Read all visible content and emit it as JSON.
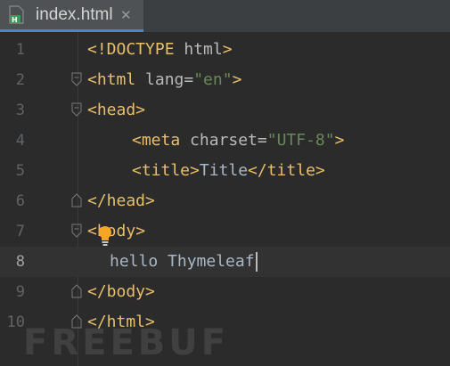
{
  "tab": {
    "title": "index.html",
    "icon": "html-file-icon",
    "close_symbol": "✕",
    "file_badge": "H"
  },
  "lines": [
    {
      "number": "1",
      "parts": [
        "<!DOCTYPE",
        " html",
        ">"
      ]
    },
    {
      "number": "2",
      "parts": [
        "<html",
        " lang=",
        "\"en\"",
        ">"
      ]
    },
    {
      "number": "3",
      "parts": [
        "<head>"
      ]
    },
    {
      "number": "4",
      "parts": [
        "<meta",
        " charset=",
        "\"UTF-8\"",
        ">"
      ]
    },
    {
      "number": "5",
      "parts": [
        "<title>",
        "Title",
        "</title>"
      ]
    },
    {
      "number": "6",
      "parts": [
        "</head>"
      ]
    },
    {
      "number": "7",
      "parts": [
        "<",
        "body>"
      ]
    },
    {
      "number": "8",
      "parts": [
        "hello Thymeleaf"
      ]
    },
    {
      "number": "9",
      "parts": [
        "</body>"
      ]
    },
    {
      "number": "10",
      "parts": [
        "</html>"
      ]
    }
  ],
  "watermark": "FREEBUF",
  "colors": {
    "tag": "#e8bf6a",
    "attribute": "#bababa",
    "string": "#6a8759",
    "text": "#a9b7c6",
    "bulb": "#f5a623"
  }
}
